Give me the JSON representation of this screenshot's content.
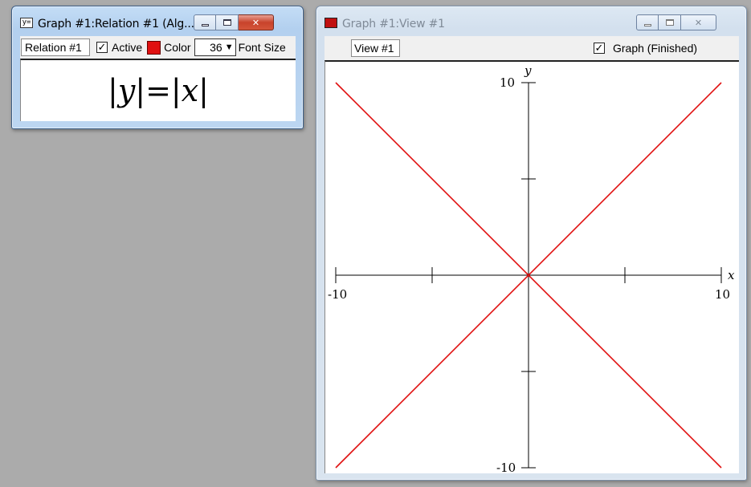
{
  "relation_window": {
    "title": "Graph #1:Relation #1 (Alg...",
    "icon": "y=",
    "relation_name": "Relation #1",
    "active_label": "Active",
    "active_checked": true,
    "color_label": "Color",
    "color": "#e01010",
    "font_size_value": "36",
    "font_size_label": "Font Size",
    "equation": "|y|=|x|"
  },
  "view_window": {
    "title": "Graph #1:View #1",
    "view_name": "View #1",
    "graph_status_label": "Graph (Finished)",
    "graph_checked": true
  },
  "chart_data": {
    "type": "line",
    "xlabel": "x",
    "ylabel": "y",
    "xlim": [
      -10,
      10
    ],
    "ylim": [
      -10,
      10
    ],
    "x_tick_labels": [
      "-10",
      "10"
    ],
    "y_tick_labels": [
      "10",
      "-10"
    ],
    "x_ticks": [
      -10,
      -5,
      0,
      5,
      10
    ],
    "y_ticks": [
      -10,
      -5,
      0,
      5,
      10
    ],
    "series": [
      {
        "color": "#e01010",
        "x": [
          -10,
          10
        ],
        "y": [
          10,
          -10
        ]
      },
      {
        "color": "#e01010",
        "x": [
          -10,
          10
        ],
        "y": [
          -10,
          10
        ]
      }
    ]
  }
}
